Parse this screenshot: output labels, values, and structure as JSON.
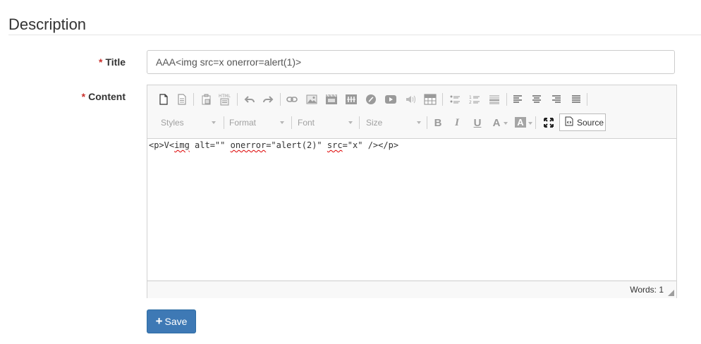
{
  "section": {
    "title": "Description"
  },
  "form": {
    "title_label": "Title",
    "title_required": "*",
    "title_value": "AAA<img src=x onerror=alert(1)>",
    "content_label": "Content",
    "content_required": "*",
    "save_label": "Save"
  },
  "editor": {
    "toolbar_row1_icons": [
      "new-page-icon",
      "preview-icon",
      "paste-icon",
      "paste-from-word-icon",
      "undo-icon",
      "redo-icon",
      "link-icon",
      "image-icon",
      "flash-icon",
      "table-icon",
      "special-char-icon",
      "youtube-icon",
      "audio-icon",
      "table-grid-icon",
      "bulleted-list-icon",
      "numbered-list-icon",
      "horizontal-rule-icon",
      "align-left-icon",
      "align-center-icon",
      "align-right-icon",
      "justify-icon"
    ],
    "combos": {
      "styles": "Styles",
      "format": "Format",
      "font": "Font",
      "size": "Size"
    },
    "format_buttons": {
      "bold": "B",
      "italic": "I",
      "underline": "U",
      "text_color": "A",
      "bg_color": "A"
    },
    "source_label": "Source",
    "content": {
      "c1": "<p>V<",
      "w1": "img",
      "c2": " alt=\"\" ",
      "w2": "onerror",
      "c3": "=\"alert(2)\" ",
      "w3": "src",
      "c4": "=\"x\" /></p>"
    },
    "status": {
      "words": "Words: 1"
    }
  }
}
